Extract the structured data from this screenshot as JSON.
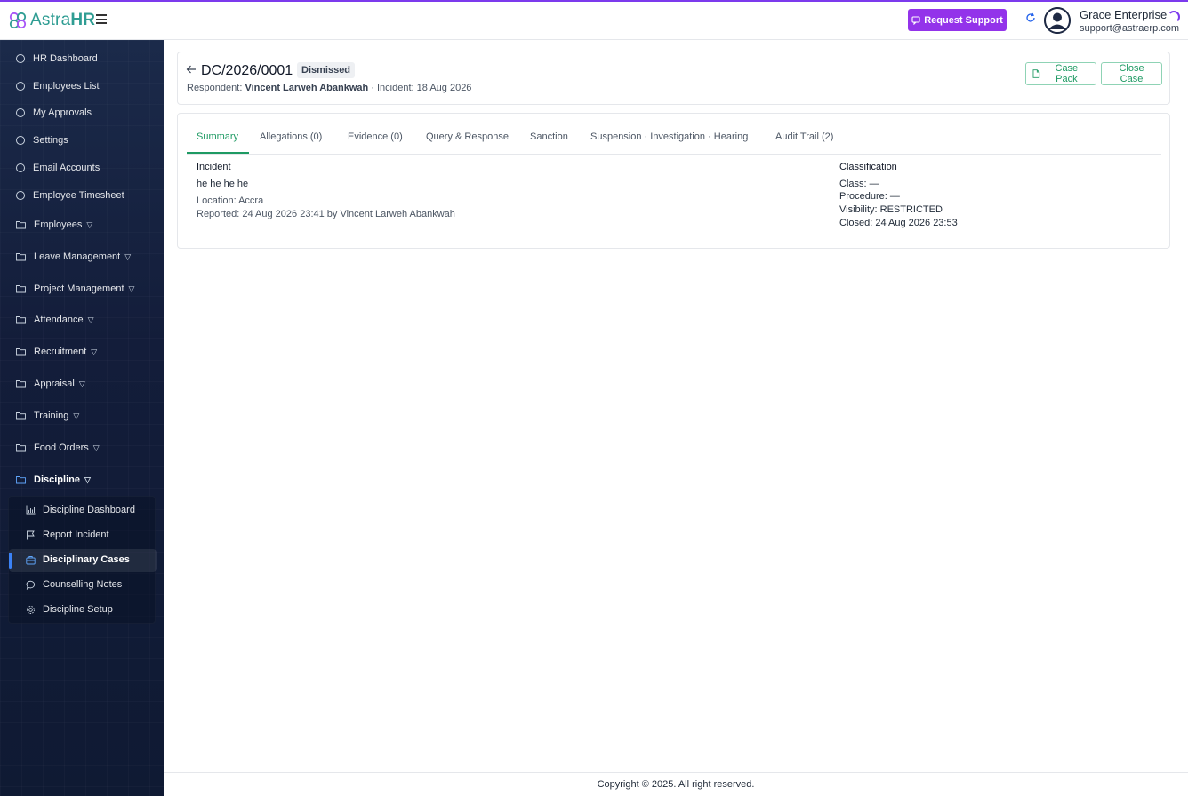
{
  "app": {
    "logo_light": "Astra",
    "logo_bold": "HR",
    "accent_color": "#7c3aed",
    "brand_color": "#2f9d93"
  },
  "header": {
    "support_button": "Request Support",
    "user_name": "Grace Enterprise",
    "user_email": "support@astraerp.com"
  },
  "sidebar": {
    "items": [
      {
        "label": "HR Dashboard",
        "icon": "circle-icon"
      },
      {
        "label": "Employees List",
        "icon": "circle-icon"
      },
      {
        "label": "My Approvals",
        "icon": "circle-icon"
      },
      {
        "label": "Settings",
        "icon": "circle-icon"
      },
      {
        "label": "Email Accounts",
        "icon": "circle-icon"
      },
      {
        "label": "Employee Timesheet",
        "icon": "circle-icon"
      }
    ],
    "groups": [
      {
        "label": "Employees"
      },
      {
        "label": "Leave Management"
      },
      {
        "label": "Project Management"
      },
      {
        "label": "Attendance"
      },
      {
        "label": "Recruitment"
      },
      {
        "label": "Appraisal"
      },
      {
        "label": "Training"
      },
      {
        "label": "Food Orders"
      },
      {
        "label": "Discipline"
      }
    ],
    "submenu": [
      {
        "label": "Discipline Dashboard",
        "icon": "bar-chart-icon"
      },
      {
        "label": "Report Incident",
        "icon": "flag-icon"
      },
      {
        "label": "Disciplinary Cases",
        "icon": "briefcase-icon"
      },
      {
        "label": "Counselling Notes",
        "icon": "chat-icon"
      },
      {
        "label": "Discipline Setup",
        "icon": "gear-icon"
      }
    ],
    "active_submenu": "Disciplinary Cases"
  },
  "case": {
    "title": "DC/2026/0001",
    "status": "Dismissed",
    "respondent_label": "Respondent:",
    "respondent_name": "Vincent Larweh Abankwah",
    "incident_text": "· Incident: 18 Aug 2026",
    "case_pack_button": "Case Pack",
    "close_case_button": "Close Case"
  },
  "tabs": [
    {
      "label": "Summary",
      "active": true
    },
    {
      "label": "Allegations (0)"
    },
    {
      "label": "Evidence (0)"
    },
    {
      "label": "Query & Response"
    },
    {
      "label": "Sanction"
    },
    {
      "label": "Suspension · Investigation · Hearing"
    },
    {
      "label": "Audit Trail (2)"
    }
  ],
  "summary": {
    "incident_title": "Incident",
    "incident_description": "he he he he",
    "location": "Location: Accra",
    "reported": "Reported: 24 Aug 2026 23:41 by Vincent Larweh Abankwah",
    "classification_title": "Classification",
    "class": "Class: —",
    "procedure": "Procedure: —",
    "visibility": "Visibility: RESTRICTED",
    "closed": "Closed: 24 Aug 2026 23:53"
  },
  "footer": {
    "copyright": "Copyright © 2025. All right reserved."
  }
}
